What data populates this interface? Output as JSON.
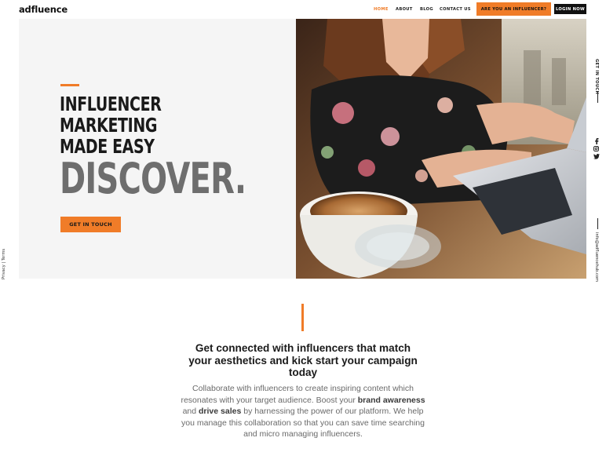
{
  "header": {
    "logo": "adfluence",
    "nav": [
      {
        "label": "HOME",
        "active": true
      },
      {
        "label": "ABOUT",
        "active": false
      },
      {
        "label": "BLOG",
        "active": false
      },
      {
        "label": "CONTACT US",
        "active": false
      }
    ],
    "cta_influencer": "ARE YOU AN INFLUENCER?",
    "cta_login": "LOGIN NOW"
  },
  "hero": {
    "title_lines": [
      "INFLUENCER",
      "MARKETING",
      "MADE EASY"
    ],
    "big_word": "DISCOVER.",
    "button": "GET IN TOUCH"
  },
  "side": {
    "left_links": "Privacy | Terms",
    "right_cta": "GET IN TOUCH",
    "social_icons": [
      "facebook-icon",
      "instagram-icon",
      "twitter-icon"
    ],
    "email": "info@adfluencehub.com"
  },
  "section": {
    "heading": "Get connected with influencers that match your aesthetics and kick start your campaign today",
    "body_1": "Collaborate with influencers to create inspiring content which resonates with your target audience. Boost your ",
    "body_bold_1": "brand awareness",
    "body_2": " and ",
    "body_bold_2": "drive sales",
    "body_3": " by harnessing the power of our platform. We help you manage this collaboration so that you can save time searching and micro managing influencers."
  },
  "colors": {
    "accent": "#f07c28",
    "dark": "#111111",
    "hero_bg": "#f5f5f5"
  }
}
